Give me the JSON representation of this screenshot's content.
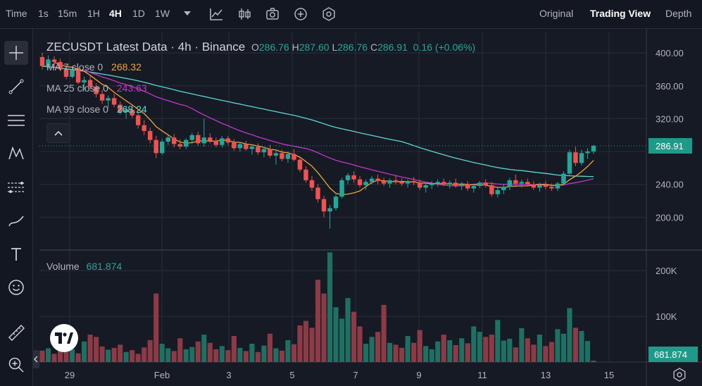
{
  "toolbar": {
    "time_label": "Time",
    "intervals": [
      "1s",
      "15m",
      "1H",
      "4H",
      "1D",
      "1W"
    ],
    "active_interval": "4H",
    "view_tabs": [
      "Original",
      "Trading View",
      "Depth"
    ],
    "active_view": "Trading View"
  },
  "header": {
    "symbol_title": "ZECUSDT Latest Data",
    "interval": "4h",
    "exchange": "Binance",
    "ohlc": [
      {
        "key": "O",
        "value": "286.76"
      },
      {
        "key": "H",
        "value": "287.60"
      },
      {
        "key": "L",
        "value": "286.76"
      },
      {
        "key": "C",
        "value": "286.91"
      }
    ],
    "change": "0.16 (+0.06%)"
  },
  "indicators": [
    {
      "label": "MA 7 close 0",
      "value": "268.32",
      "color": "#f0a43c"
    },
    {
      "label": "MA 25 close 0",
      "value": "243.63",
      "color": "#c238c8"
    },
    {
      "label": "MA 99 close 0",
      "value": "268.24",
      "color": "#5fd6d6"
    }
  ],
  "volume_legend": {
    "label": "Volume",
    "value": "681.874"
  },
  "colors": {
    "up": "#26a69a",
    "down": "#ef5350",
    "up_vol": "#1f6f63",
    "down_vol": "#8c3a45",
    "bg": "#161a25",
    "grid": "#2a2e39",
    "price_tag": "#1f9a88",
    "ma7": "#f0a43c",
    "ma25": "#c238c8",
    "ma99": "#5fd6d6"
  },
  "chart_data": {
    "type": "candlestick",
    "title": "ZECUSDT Latest Data · 4h · Binance",
    "x_tick_labels": [
      "29",
      "Feb",
      "3",
      "5",
      "7",
      "9",
      "11",
      "13",
      "15"
    ],
    "price_axis_ticks": [
      "400.00",
      "360.00",
      "320.00",
      "240.00",
      "200.00"
    ],
    "price_ylim": [
      160,
      425
    ],
    "volume_axis_ticks": [
      "200K",
      "100K"
    ],
    "volume_ylim": [
      0,
      245000
    ],
    "last_price": "286.91",
    "last_volume": "681.874",
    "candles": [
      [
        395,
        400,
        380,
        384
      ],
      [
        384,
        397,
        381,
        392
      ],
      [
        392,
        396,
        383,
        389
      ],
      [
        389,
        393,
        378,
        380
      ],
      [
        380,
        385,
        368,
        371
      ],
      [
        371,
        383,
        369,
        380
      ],
      [
        380,
        382,
        362,
        364
      ],
      [
        364,
        371,
        355,
        367
      ],
      [
        367,
        372,
        356,
        359
      ],
      [
        359,
        363,
        346,
        350
      ],
      [
        350,
        355,
        338,
        342
      ],
      [
        342,
        348,
        333,
        345
      ],
      [
        345,
        350,
        334,
        337
      ],
      [
        337,
        341,
        325,
        328
      ],
      [
        328,
        335,
        320,
        331
      ],
      [
        331,
        336,
        321,
        324
      ],
      [
        324,
        328,
        308,
        312
      ],
      [
        312,
        318,
        300,
        305
      ],
      [
        305,
        309,
        290,
        294
      ],
      [
        294,
        299,
        272,
        278
      ],
      [
        278,
        295,
        276,
        292
      ],
      [
        292,
        300,
        288,
        297
      ],
      [
        297,
        301,
        285,
        289
      ],
      [
        289,
        295,
        283,
        286
      ],
      [
        286,
        296,
        283,
        294
      ],
      [
        294,
        303,
        289,
        300
      ],
      [
        300,
        304,
        287,
        290
      ],
      [
        290,
        320,
        286,
        297
      ],
      [
        297,
        302,
        290,
        293
      ],
      [
        293,
        297,
        285,
        288
      ],
      [
        288,
        299,
        285,
        296
      ],
      [
        296,
        299,
        288,
        291
      ],
      [
        291,
        295,
        281,
        284
      ],
      [
        284,
        292,
        280,
        289
      ],
      [
        289,
        293,
        281,
        283
      ],
      [
        283,
        289,
        276,
        286
      ],
      [
        286,
        290,
        276,
        279
      ],
      [
        279,
        286,
        273,
        283
      ],
      [
        283,
        288,
        272,
        275
      ],
      [
        275,
        282,
        264,
        278
      ],
      [
        278,
        282,
        268,
        271
      ],
      [
        271,
        280,
        266,
        277
      ],
      [
        277,
        283,
        268,
        270
      ],
      [
        270,
        274,
        255,
        258
      ],
      [
        258,
        262,
        242,
        245
      ],
      [
        245,
        250,
        232,
        236
      ],
      [
        236,
        240,
        218,
        222
      ],
      [
        222,
        226,
        200,
        207
      ],
      [
        207,
        215,
        186,
        211
      ],
      [
        211,
        228,
        208,
        225
      ],
      [
        225,
        248,
        223,
        245
      ],
      [
        245,
        254,
        240,
        251
      ],
      [
        251,
        256,
        242,
        246
      ],
      [
        246,
        250,
        236,
        239
      ],
      [
        239,
        246,
        233,
        243
      ],
      [
        243,
        250,
        240,
        247
      ],
      [
        247,
        252,
        240,
        244
      ],
      [
        244,
        248,
        238,
        241
      ],
      [
        241,
        247,
        236,
        245
      ],
      [
        245,
        250,
        240,
        243
      ],
      [
        243,
        247,
        238,
        241
      ],
      [
        241,
        246,
        236,
        244
      ],
      [
        244,
        249,
        239,
        242
      ],
      [
        242,
        246,
        233,
        236
      ],
      [
        236,
        242,
        230,
        239
      ],
      [
        239,
        244,
        234,
        241
      ],
      [
        241,
        246,
        237,
        243
      ],
      [
        243,
        247,
        238,
        240
      ],
      [
        240,
        245,
        235,
        242
      ],
      [
        242,
        247,
        236,
        238
      ],
      [
        238,
        243,
        233,
        240
      ],
      [
        240,
        244,
        232,
        235
      ],
      [
        235,
        241,
        230,
        238
      ],
      [
        238,
        244,
        235,
        242
      ],
      [
        242,
        246,
        236,
        239
      ],
      [
        239,
        243,
        225,
        228
      ],
      [
        228,
        236,
        224,
        233
      ],
      [
        233,
        240,
        228,
        237
      ],
      [
        237,
        248,
        233,
        245
      ],
      [
        245,
        252,
        238,
        241
      ],
      [
        241,
        246,
        236,
        243
      ],
      [
        243,
        247,
        238,
        240
      ],
      [
        240,
        244,
        233,
        236
      ],
      [
        236,
        242,
        231,
        239
      ],
      [
        239,
        244,
        234,
        237
      ],
      [
        237,
        241,
        232,
        235
      ],
      [
        235,
        243,
        232,
        241
      ],
      [
        241,
        256,
        239,
        253
      ],
      [
        253,
        282,
        250,
        279
      ],
      [
        279,
        286,
        262,
        266
      ],
      [
        266,
        282,
        263,
        278
      ],
      [
        278,
        284,
        271,
        280
      ],
      [
        280,
        288,
        277,
        287
      ]
    ],
    "volumes": [
      25000,
      30000,
      18000,
      40000,
      22000,
      28000,
      19000,
      45000,
      60000,
      55000,
      34000,
      27000,
      31000,
      38000,
      22000,
      26000,
      18000,
      32000,
      48000,
      150000,
      40000,
      30000,
      24000,
      52000,
      28000,
      33000,
      45000,
      60000,
      42000,
      28000,
      35000,
      26000,
      57000,
      31000,
      24000,
      40000,
      22000,
      36000,
      62000,
      30000,
      25000,
      48000,
      39000,
      80000,
      90000,
      75000,
      180000,
      150000,
      240000,
      120000,
      95000,
      140000,
      110000,
      78000,
      40000,
      55000,
      66000,
      125000,
      42000,
      38000,
      31000,
      57000,
      42000,
      70000,
      35000,
      28000,
      45000,
      60000,
      48000,
      37000,
      52000,
      41000,
      78000,
      66000,
      55000,
      60000,
      92000,
      47000,
      51000,
      32000,
      74000,
      52000,
      38000,
      60000,
      35000,
      44000,
      72000,
      62000,
      118000,
      75000,
      68000,
      46000,
      3000
    ]
  }
}
